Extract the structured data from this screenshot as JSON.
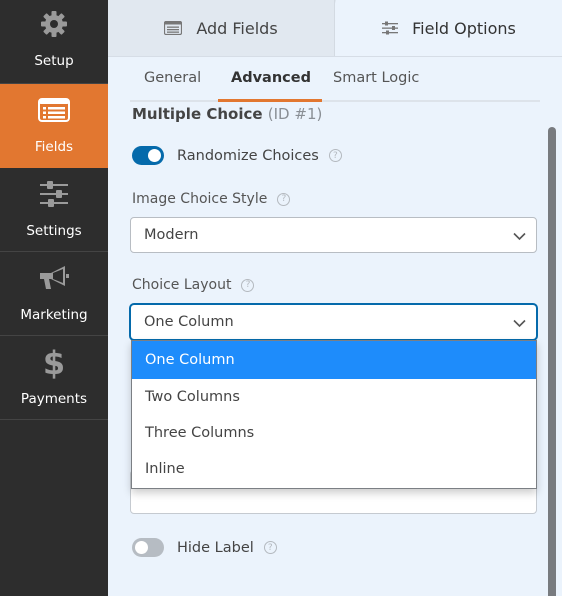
{
  "sidebar": {
    "items": [
      {
        "label": "Setup",
        "icon": "gear-icon",
        "active": false
      },
      {
        "label": "Fields",
        "icon": "fields-list-icon",
        "active": true
      },
      {
        "label": "Settings",
        "icon": "sliders-icon",
        "active": false
      },
      {
        "label": "Marketing",
        "icon": "megaphone-icon",
        "active": false
      },
      {
        "label": "Payments",
        "icon": "dollar-icon",
        "active": false
      }
    ]
  },
  "panel_tabs": {
    "add_fields": "Add Fields",
    "field_options": "Field Options",
    "active": "Field Options"
  },
  "sub_tabs": {
    "items": [
      "General",
      "Advanced",
      "Smart Logic"
    ],
    "active": "Advanced"
  },
  "field": {
    "name": "Multiple Choice",
    "id_label": "(ID #1)"
  },
  "options": {
    "randomize": {
      "label": "Randomize Choices",
      "enabled": true
    },
    "image_choice_style": {
      "label": "Image Choice Style",
      "value": "Modern"
    },
    "choice_layout": {
      "label": "Choice Layout",
      "value": "One Column",
      "options": [
        "One Column",
        "Two Columns",
        "Three Columns",
        "Inline"
      ],
      "highlighted": "One Column"
    },
    "hide_label": {
      "label": "Hide Label",
      "enabled": false
    }
  },
  "help_glyph": "?",
  "colors": {
    "accent_orange": "#e27730",
    "toggle_on": "#056aab",
    "dropdown_highlight": "#1e8cfb",
    "sidebar_bg": "#2d2d2d",
    "panel_bg": "#ebf3fc"
  }
}
